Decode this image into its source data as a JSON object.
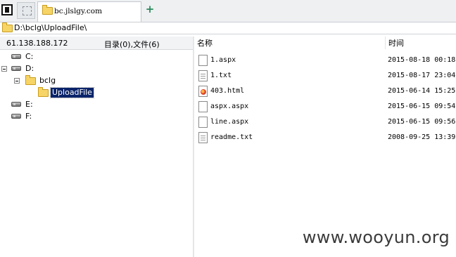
{
  "tab": {
    "title": "bc.jlslgy.com",
    "add_symbol": "+"
  },
  "path": "D:\\bclg\\UploadFile\\",
  "left_header": {
    "ip": "61.138.188.172",
    "counts": "目录(0),文件(6)"
  },
  "right_header": {
    "name": "名称",
    "time": "时间"
  },
  "tree": [
    {
      "label": "C:",
      "icon": "drive-icon"
    },
    {
      "label": "D:",
      "icon": "drive-icon",
      "expanded": true
    },
    {
      "label": "bclg",
      "icon": "folder-icon",
      "expanded": true
    },
    {
      "label": "UploadFile",
      "icon": "folder-open-icon",
      "selected": true
    },
    {
      "label": "E:",
      "icon": "drive-icon"
    },
    {
      "label": "F:",
      "icon": "drive-icon"
    }
  ],
  "files": [
    {
      "name": "1.aspx",
      "time": "2015-08-18 00:18",
      "icon": "document-icon"
    },
    {
      "name": "1.txt",
      "time": "2015-08-17 23:04",
      "icon": "text-file-icon"
    },
    {
      "name": "403.html",
      "time": "2015-06-14 15:25",
      "icon": "html-file-icon"
    },
    {
      "name": "aspx.aspx",
      "time": "2015-06-15 09:54",
      "icon": "document-icon"
    },
    {
      "name": "line.aspx",
      "time": "2015-06-15 09:56",
      "icon": "document-icon"
    },
    {
      "name": "readme.txt",
      "time": "2008-09-25 13:39",
      "icon": "text-file-icon"
    }
  ],
  "watermark": "www.wooyun.org",
  "colors": {
    "selection": "#0a246a",
    "folder": "#f6d466"
  }
}
